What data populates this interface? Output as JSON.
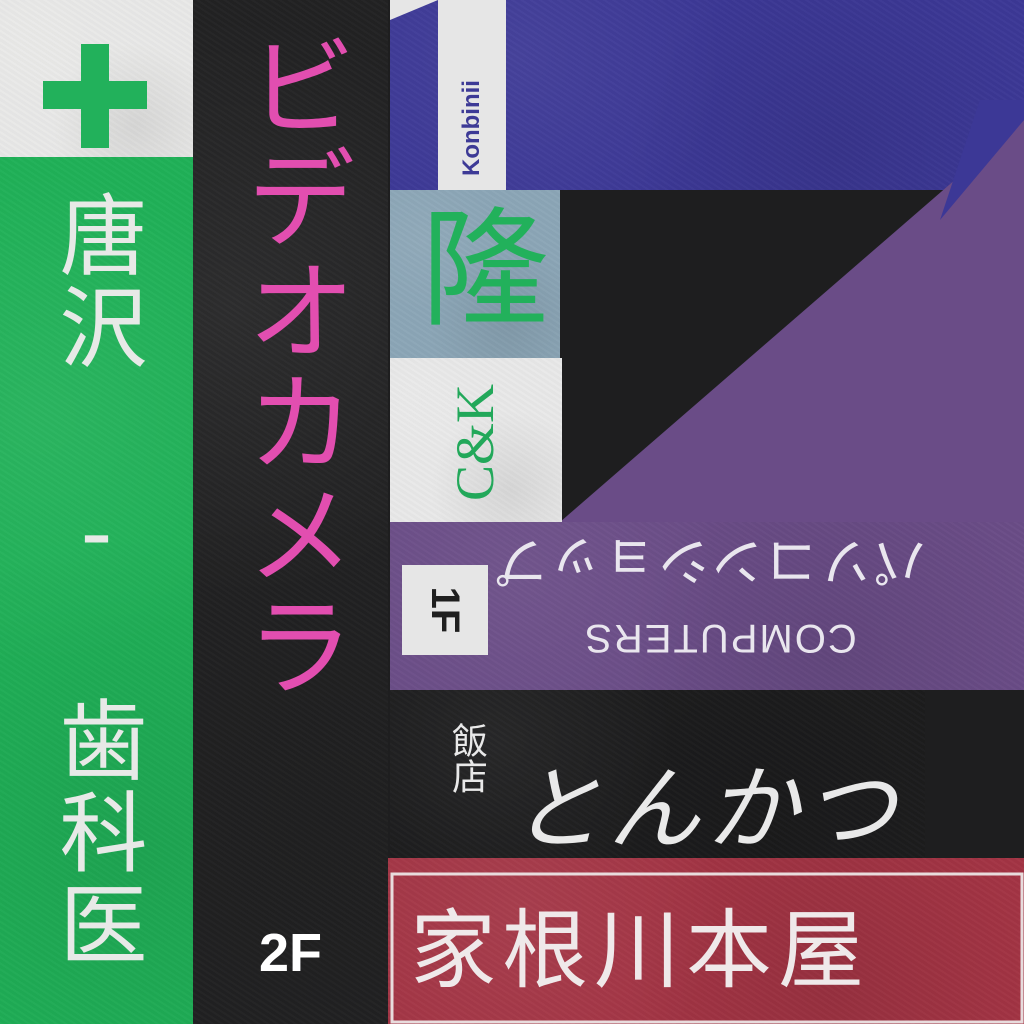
{
  "signs": {
    "dental": {
      "name": "唐沢 - 歯科医院",
      "icon": "cross-icon",
      "color": "#20b158"
    },
    "video": {
      "name": "ビデオカメラ",
      "floor": "2F",
      "color": "#e24eb0"
    },
    "konbini": {
      "name": "Konbinii",
      "color": "#3c3896"
    },
    "takashi": {
      "name": "隆",
      "color": "#22b15b"
    },
    "ck": {
      "name": "C&K",
      "color": "#22a85a"
    },
    "computers": {
      "kana": "パソコンショップ",
      "english": "COMPUTERS",
      "floor": "1F",
      "color": "#6a4c87"
    },
    "restaurant": {
      "small": "飯店",
      "name": "とんかつ",
      "color": "#1c1c1d"
    },
    "red_shop": {
      "name": "家根川本屋",
      "color": "#a33444"
    }
  }
}
